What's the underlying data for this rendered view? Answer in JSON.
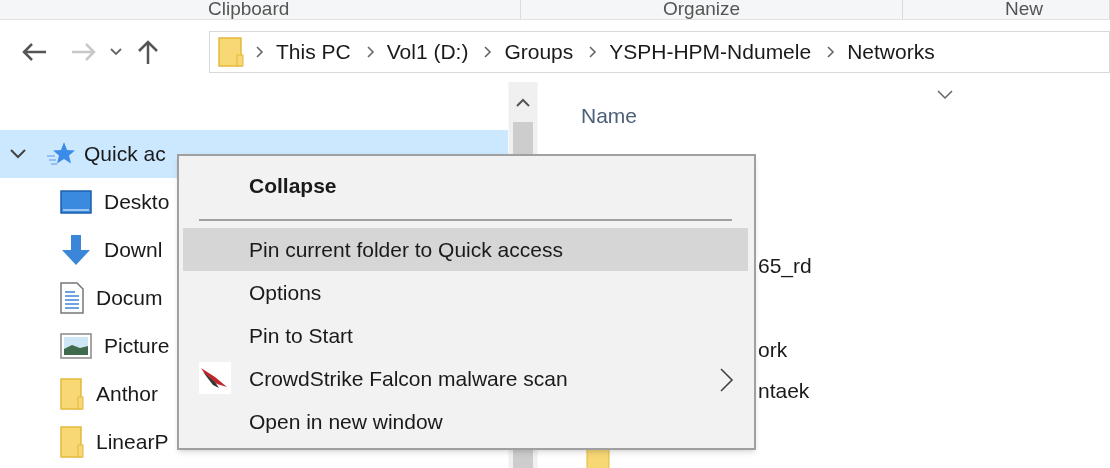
{
  "ribbon_groups": [
    "Clipboard",
    "Organize",
    "New"
  ],
  "breadcrumb": [
    "This PC",
    "Vol1 (D:)",
    "Groups",
    "YSPH-HPM-Ndumele",
    "Networks"
  ],
  "nav_pane": {
    "items": [
      {
        "label": "Quick ac",
        "kind": "star",
        "selected": true
      },
      {
        "label": "Deskto",
        "kind": "desktop",
        "selected": false
      },
      {
        "label": "Downl",
        "kind": "download",
        "selected": false
      },
      {
        "label": "Docum",
        "kind": "document",
        "selected": false
      },
      {
        "label": "Picture",
        "kind": "pictures",
        "selected": false
      },
      {
        "label": "Anthor",
        "kind": "folder",
        "selected": false
      },
      {
        "label": "LinearP",
        "kind": "folder",
        "selected": false
      }
    ]
  },
  "file_list": {
    "column": "Name",
    "items": [
      {
        "label": "65_rd"
      },
      {
        "label": "ork"
      },
      {
        "label": "ntaek"
      }
    ]
  },
  "context_menu": {
    "items": [
      {
        "label": "Collapse",
        "kind": "bold",
        "highlighted": false
      },
      {
        "kind": "separator"
      },
      {
        "label": "Pin current folder to Quick access",
        "kind": "item",
        "highlighted": true
      },
      {
        "label": "Options",
        "kind": "item",
        "highlighted": false
      },
      {
        "label": "Pin to Start",
        "kind": "item",
        "highlighted": false
      },
      {
        "label": "CrowdStrike Falcon malware scan",
        "kind": "submenu",
        "highlighted": false
      },
      {
        "label": "Open in new window",
        "kind": "item",
        "highlighted": false
      }
    ]
  }
}
